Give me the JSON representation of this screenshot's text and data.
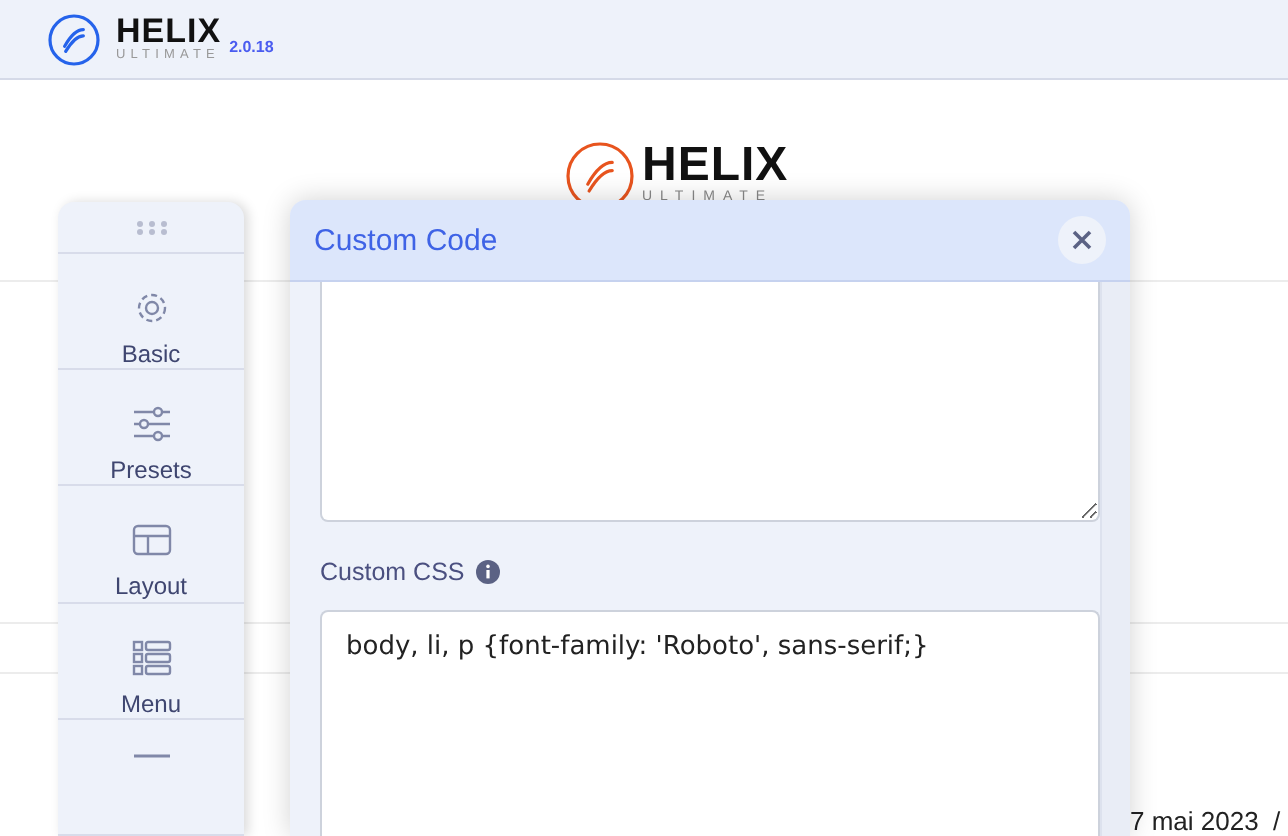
{
  "header": {
    "logo_title": "HELIX",
    "logo_subtitle": "ULTIMATE",
    "version": "2.0.18"
  },
  "preview": {
    "logo_title": "HELIX",
    "logo_subtitle": "ULTIMATE",
    "date_text": "7 mai 2023  /"
  },
  "sidebar": {
    "items": [
      {
        "kind": "nav",
        "label": "Basic"
      },
      {
        "kind": "nav",
        "label": "Presets"
      },
      {
        "kind": "nav",
        "label": "Layout"
      },
      {
        "kind": "nav",
        "label": "Menu"
      },
      {
        "kind": "nav"
      }
    ]
  },
  "modal": {
    "title": "Custom Code",
    "fields": [
      {
        "kind": "textarea"
      },
      {
        "kind": "textarea",
        "label": "Custom CSS",
        "info": true,
        "value": "body, li, p {font-family: 'Roboto', sans-serif;}"
      }
    ]
  }
}
